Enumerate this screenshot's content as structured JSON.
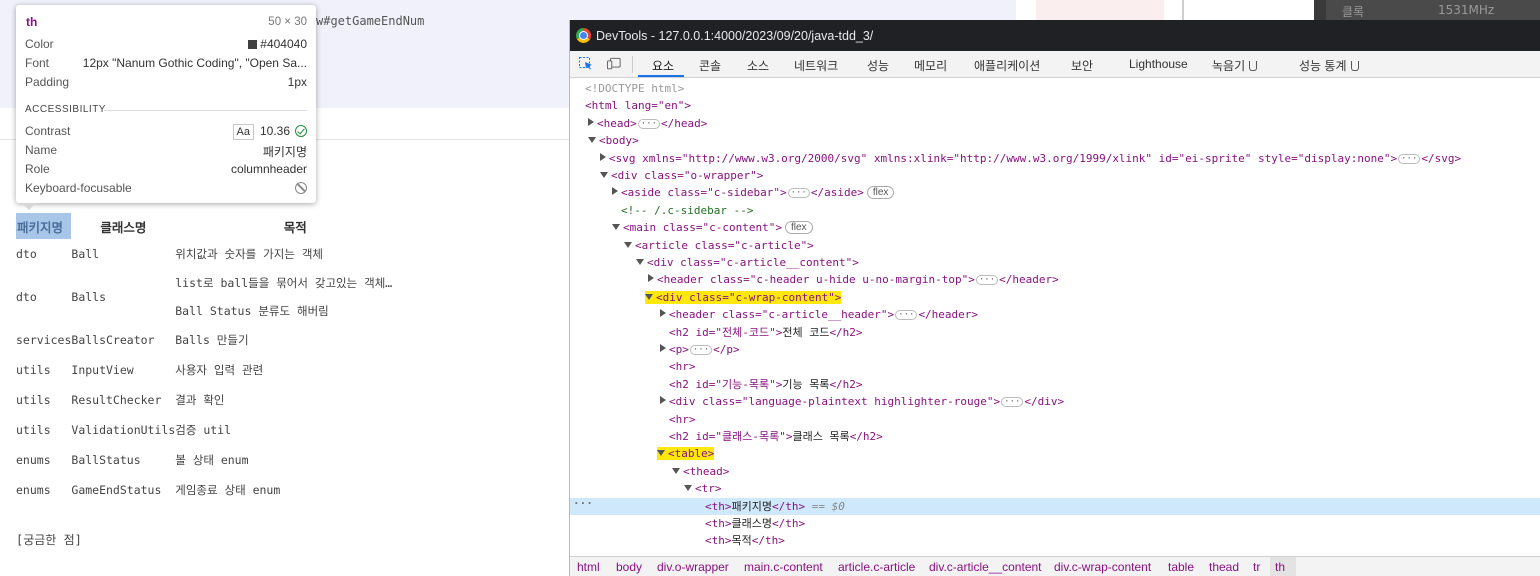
{
  "page": {
    "code_line": "w#getGameEndNum",
    "table": {
      "headers": [
        "패키지명",
        "클래스명",
        "목적"
      ],
      "rows": [
        {
          "pkg": "dto",
          "cls": "Ball",
          "purpose": "위치값과 숫자를 가지는 객체"
        },
        {
          "pkg": "dto",
          "cls": "Balls",
          "purpose": "list로 ball들을 묶어서 갖고있는 객체…",
          "purpose2": "Ball Status 분류도 해버림"
        },
        {
          "pkg": "services",
          "cls": "BallsCreator",
          "purpose": "Balls 만들기"
        },
        {
          "pkg": "utils",
          "cls": "InputView",
          "purpose": "사용자 입력 관련"
        },
        {
          "pkg": "utils",
          "cls": "ResultChecker",
          "purpose": "결과 확인"
        },
        {
          "pkg": "utils",
          "cls": "ValidationUtils",
          "purpose": "검증 util"
        },
        {
          "pkg": "enums",
          "cls": "BallStatus",
          "purpose": "볼 상태 enum"
        },
        {
          "pkg": "enums",
          "cls": "GameEndStatus",
          "purpose": "게임종료 상태 enum"
        }
      ]
    },
    "question": "[궁금한 점]"
  },
  "deco": {
    "a": "클록",
    "b": "1531MHz"
  },
  "tooltip": {
    "tag": "th",
    "size": "50 × 30",
    "color_label": "Color",
    "color_value": "#404040",
    "font_label": "Font",
    "font_value": "12px \"Nanum Gothic Coding\", \"Open Sa...",
    "padding_label": "Padding",
    "padding_value": "1px",
    "accessibility_title": "ACCESSIBILITY",
    "contrast_label": "Contrast",
    "contrast_aa": "Aa",
    "contrast_value": "10.36",
    "name_label": "Name",
    "name_value": "패키지명",
    "role_label": "Role",
    "role_value": "columnheader",
    "kbd_label": "Keyboard-focusable"
  },
  "devtools": {
    "title": "DevTools - 127.0.0.1:4000/2023/09/20/java-tdd_3/",
    "tabs": [
      "요소",
      "콘솔",
      "소스",
      "네트워크",
      "성능",
      "메모리",
      "애플리케이션",
      "보안",
      "Lighthouse",
      "녹음기",
      "성능 통계"
    ],
    "eq0": "== $0",
    "breadcrumbs": [
      "html",
      "body",
      "div.o-wrapper",
      "main.c-content",
      "article.c-article",
      "div.c-article__content",
      "div.c-wrap-content",
      "table",
      "thead",
      "tr",
      "th"
    ],
    "dom": {
      "doctype": "<!DOCTYPE html>",
      "html_open": "<html lang=\"en\">",
      "head": "<head>",
      "head_close": "</head>",
      "body": "<body>",
      "svg": "<svg xmlns=\"http://www.w3.org/2000/svg\" xmlns:xlink=\"http://www.w3.org/1999/xlink\" id=\"ei-sprite\" style=\"display:none\">",
      "svg_close": "</svg>",
      "wrapper": "<div class=\"o-wrapper\">",
      "aside": "<aside class=\"c-sidebar\">",
      "aside_close": "</aside>",
      "comment": "<!-- /.c-sidebar -->",
      "main": "<main class=\"c-content\">",
      "article": "<article class=\"c-article\">",
      "article_content": "<div class=\"c-article__content\">",
      "header1": "<header class=\"c-header u-hide u-no-margin-top\">",
      "header_close": "</header>",
      "wrap_content": "<div class=\"c-wrap-content\">",
      "header2": "<header class=\"c-article__header\">",
      "h2a_open": "<h2 id=\"전체-코드\">",
      "h2a_text": "전체 코드",
      "h2_close": "</h2>",
      "p_open": "<p>",
      "p_close": "</p>",
      "hr": "<hr>",
      "h2b_open": "<h2 id=\"기능-목록\">",
      "h2b_text": "기능 목록",
      "div_lang": "<div class=\"language-plaintext highlighter-rouge\">",
      "div_close": "</div>",
      "h2c_open": "<h2 id=\"클래스-목록\">",
      "h2c_text": "클래스 목록",
      "table": "<table>",
      "thead": "<thead>",
      "tr": "<tr>",
      "th_open": "<th>",
      "th_close": "</th>",
      "th1": "패키지명",
      "th2": "클래스명",
      "th3": "목적",
      "flex": "flex"
    }
  },
  "colors": {
    "accent": "#1a73e8",
    "selection": "#cfe8fc",
    "highlight": "#ffe80a",
    "tag": "#881280"
  }
}
